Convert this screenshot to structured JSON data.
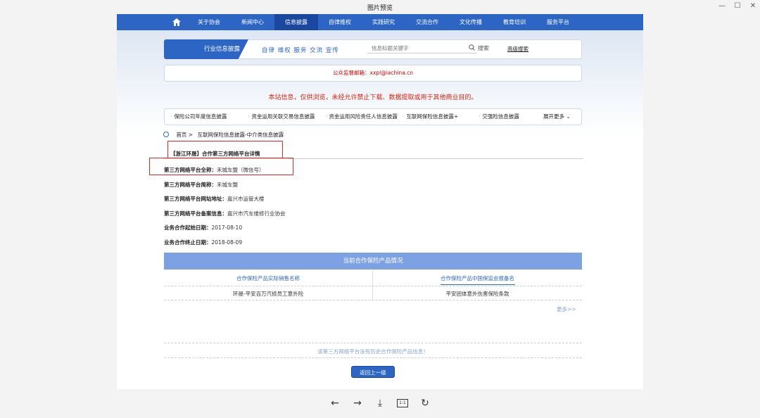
{
  "window": {
    "title": "图片预览",
    "controls": {
      "minimize": "—",
      "maximize": "☐",
      "close": "✕"
    }
  },
  "nav": {
    "home_icon": "home-icon",
    "items": [
      "关于协会",
      "新闻中心",
      "信息披露",
      "自律维权",
      "实践研究",
      "交流合作",
      "文化传播",
      "教育培训",
      "服务平台"
    ],
    "active_index": 2
  },
  "search": {
    "tab_label": "行业信息披露",
    "slogan": "自律 维权 服务 交流 宣传",
    "placeholder": "信息标题关键字",
    "button": "搜索",
    "advanced": "高级搜索"
  },
  "email": "公众监督邮箱：xxpl@iachina.cn",
  "notice": "本站信息，仅供浏览，未经允许禁止下载、数据提取或用于其他商业目的。",
  "categories": [
    "保险公司年度信息披露",
    "资金运用关联交易信息披露",
    "资金运用风险责任人信息披露",
    "互联网保险信息披露+",
    "交强险信息披露"
  ],
  "expand_more": "展开更多 ⌄",
  "breadcrumb": {
    "home": "首页 >",
    "path": "互联网保险信息披露-中介类信息披露"
  },
  "detail_title": "【浙江环晟】合作第三方网络平台详情",
  "fields": [
    {
      "label": "第三方网络平台全称：",
      "value": "禾城车盟（微信号）"
    },
    {
      "label": "第三方网络平台简称：",
      "value": "禾城车盟"
    },
    {
      "label": "第三方网络平台网站地址：",
      "value": "嘉兴市运管大楼"
    },
    {
      "label": "第三方网络平台备案信息：",
      "value": "嘉兴市汽车维修行业协会"
    },
    {
      "label": "业务合作起始日期：",
      "value": "2017-08-10"
    },
    {
      "label": "业务合作终止日期：",
      "value": "2018-08-09"
    }
  ],
  "products": {
    "header": "当前合作保险产品情况",
    "columns": [
      "合作保险产品实际销售名称",
      "合作保险产品中国保监会报备名"
    ],
    "rows": [
      [
        "环晟-平安百万汽修员工意外险",
        "平安团体意外伤害保险条款"
      ]
    ],
    "more": "更多>>"
  },
  "no_history": "该第三方网络平台没有历史合作保险产品信息！",
  "back_button": "返回上一级",
  "toolbar": {
    "prev": "←",
    "next": "→",
    "download": "⤓",
    "actual_size": "1:1",
    "rotate": "↻"
  },
  "colors": {
    "primary": "#2c65c4",
    "notice": "#d9230f",
    "highlight_box": "#e02a2a",
    "table_header": "#7da2e4"
  }
}
